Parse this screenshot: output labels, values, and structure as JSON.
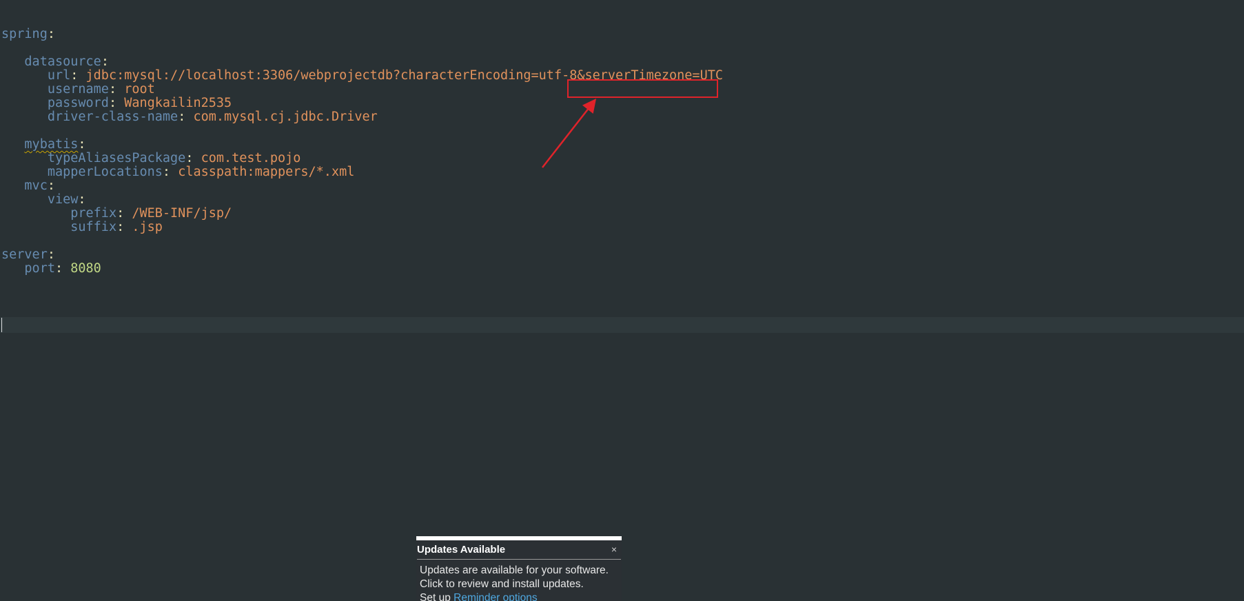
{
  "editor": {
    "lines": [
      {
        "key": "spring",
        "sep": ":",
        "value": "",
        "indent": ""
      },
      {
        "key": "datasource",
        "sep": ":",
        "value": "",
        "indent": "   "
      },
      {
        "key": "url",
        "sep": ": ",
        "value": "jdbc:mysql://localhost:3306/webprojectdb?characterEncoding=utf-8&serverTimezone=UTC",
        "indent": "      "
      },
      {
        "key": "username",
        "sep": ": ",
        "value": "root",
        "indent": "      "
      },
      {
        "key": "password",
        "sep": ": ",
        "value": "Wangkailin2535",
        "indent": "      "
      },
      {
        "key": "driver-class-name",
        "sep": ": ",
        "value": "com.mysql.cj.jdbc.Driver",
        "indent": "      "
      },
      {
        "key": "mybatis",
        "sep": ":",
        "value": "",
        "indent": "   "
      },
      {
        "key": "typeAliasesPackage",
        "sep": ": ",
        "value": "com.test.pojo",
        "indent": "      "
      },
      {
        "key": "mapperLocations",
        "sep": ": ",
        "value": "classpath:mappers/*.xml",
        "indent": "      "
      },
      {
        "key": "mvc",
        "sep": ":",
        "value": "",
        "indent": "   "
      },
      {
        "key": "view",
        "sep": ":",
        "value": "",
        "indent": "      "
      },
      {
        "key": "prefix",
        "sep": ": ",
        "value": "/WEB-INF/jsp/",
        "indent": "         "
      },
      {
        "key": "suffix",
        "sep": ": ",
        "value": ".jsp",
        "indent": "         "
      },
      {
        "key": "server",
        "sep": ":",
        "value": "",
        "indent": ""
      },
      {
        "key": "port",
        "sep": ": ",
        "value": "8080",
        "indent": "   "
      }
    ],
    "url_prefix": "jdbc:mysql://localhost:3306/webprojectdb?characterEncoding=utf-8",
    "url_highlight": "&serverTimezone=UTC"
  },
  "notification": {
    "title": "Updates Available",
    "close_label": "×",
    "message_line1": "Updates are available for your software.",
    "message_line2": "Click to review and install updates.",
    "setup_prefix": "Set up ",
    "setup_link": "Reminder options"
  },
  "colors": {
    "background": "#293134",
    "key": "#678cb1",
    "string": "#e1925c",
    "number": "#c0d785",
    "annotation": "#e0232a"
  }
}
